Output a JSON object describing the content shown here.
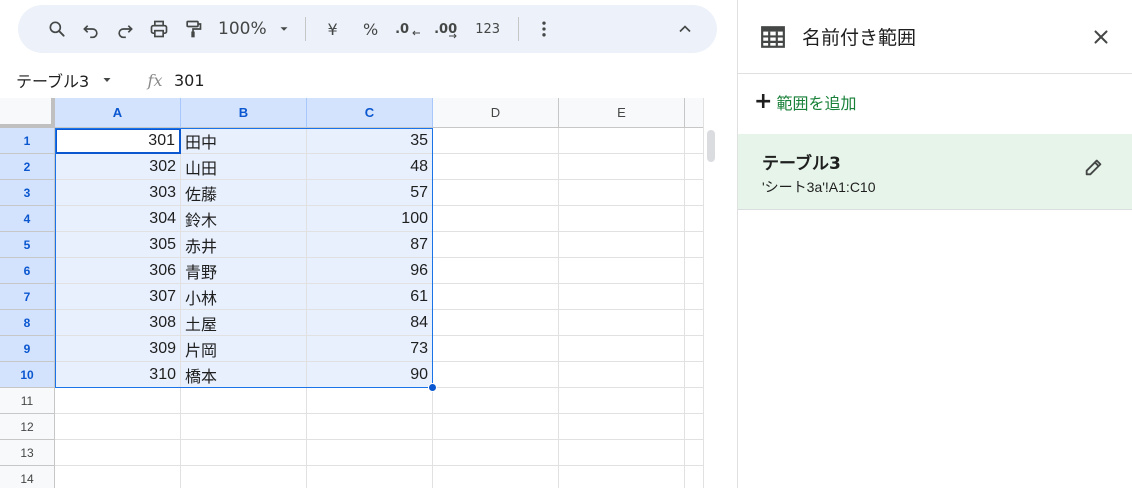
{
  "toolbar": {
    "zoom": "100%",
    "currency": "¥",
    "percent": "%",
    "decrease_decimal": ".0",
    "increase_decimal": ".00",
    "number_format": "123",
    "icons": [
      "search-icon",
      "undo-icon",
      "redo-icon",
      "print-icon",
      "paint-format-icon",
      "chevron-down-icon",
      "more-vert-icon",
      "chevron-up-icon"
    ]
  },
  "formula_bar": {
    "name_box": "テーブル3",
    "fx": "fx",
    "value": "301"
  },
  "grid": {
    "columns": [
      "A",
      "B",
      "C",
      "D",
      "E"
    ],
    "selected_columns": [
      "A",
      "B",
      "C"
    ],
    "rows": [
      {
        "n": "1",
        "a": "301",
        "b": "田中",
        "c": "35"
      },
      {
        "n": "2",
        "a": "302",
        "b": "山田",
        "c": "48"
      },
      {
        "n": "3",
        "a": "303",
        "b": "佐藤",
        "c": "57"
      },
      {
        "n": "4",
        "a": "304",
        "b": "鈴木",
        "c": "100"
      },
      {
        "n": "5",
        "a": "305",
        "b": "赤井",
        "c": "87"
      },
      {
        "n": "6",
        "a": "306",
        "b": "青野",
        "c": "96"
      },
      {
        "n": "7",
        "a": "307",
        "b": "小林",
        "c": "61"
      },
      {
        "n": "8",
        "a": "308",
        "b": "土屋",
        "c": "84"
      },
      {
        "n": "9",
        "a": "309",
        "b": "片岡",
        "c": "73"
      },
      {
        "n": "10",
        "a": "310",
        "b": "橋本",
        "c": "90"
      },
      {
        "n": "11",
        "a": "",
        "b": "",
        "c": ""
      },
      {
        "n": "12",
        "a": "",
        "b": "",
        "c": ""
      },
      {
        "n": "13",
        "a": "",
        "b": "",
        "c": ""
      },
      {
        "n": "14",
        "a": "",
        "b": "",
        "c": ""
      }
    ]
  },
  "panel": {
    "title": "名前付き範囲",
    "add_range": "範囲を追加",
    "ranges": [
      {
        "name": "テーブル3",
        "ref": "'シート3a'!A1:C10"
      }
    ]
  },
  "colors": {
    "selection": "#e8f0fe",
    "header_selected": "#d3e3fd",
    "accent": "#0b57d0",
    "panel_card": "#e6f4ea",
    "add_link": "#188038"
  }
}
